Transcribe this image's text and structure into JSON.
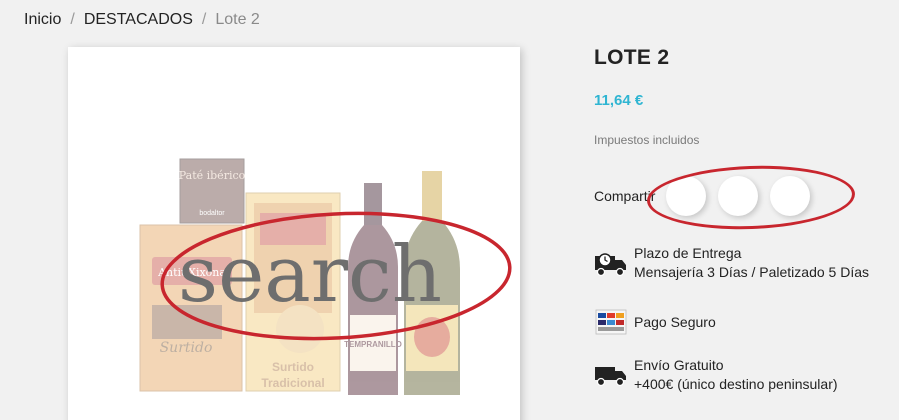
{
  "breadcrumb": {
    "items": [
      "Inicio",
      "DESTACADOS"
    ],
    "separator": "/",
    "current": "Lote 2"
  },
  "product": {
    "title": "LOTE 2",
    "price": "11,64 €",
    "tax_note": "Impuestos incluidos",
    "image_overlay_text": "search",
    "image_labels": {
      "pate_box": "Paté ibérico",
      "pate_brand": "bodaltor",
      "box_brand": "AntiuXixona",
      "box_script": "Surtido",
      "tin_label_1": "Surtido",
      "tin_label_2": "Tradicional",
      "wine_label": "TEMPRANILLO"
    }
  },
  "share": {
    "label": "Compartir",
    "buttons": [
      "facebook",
      "twitter",
      "pinterest"
    ]
  },
  "reassurance": [
    {
      "icon": "delivery-truck-clock-icon",
      "line1": "Plazo de Entrega",
      "line2": "Mensajería 3 Días / Paletizado 5 Días"
    },
    {
      "icon": "payment-cards-icon",
      "line1": "Pago Seguro",
      "line2": ""
    },
    {
      "icon": "shipping-truck-icon",
      "line1": "Envío Gratuito",
      "line2": "+400€ (único destino peninsular)"
    }
  ],
  "colors": {
    "accent": "#2fb5d2",
    "annotation": "#c8262e",
    "background": "#f1f1f1"
  }
}
